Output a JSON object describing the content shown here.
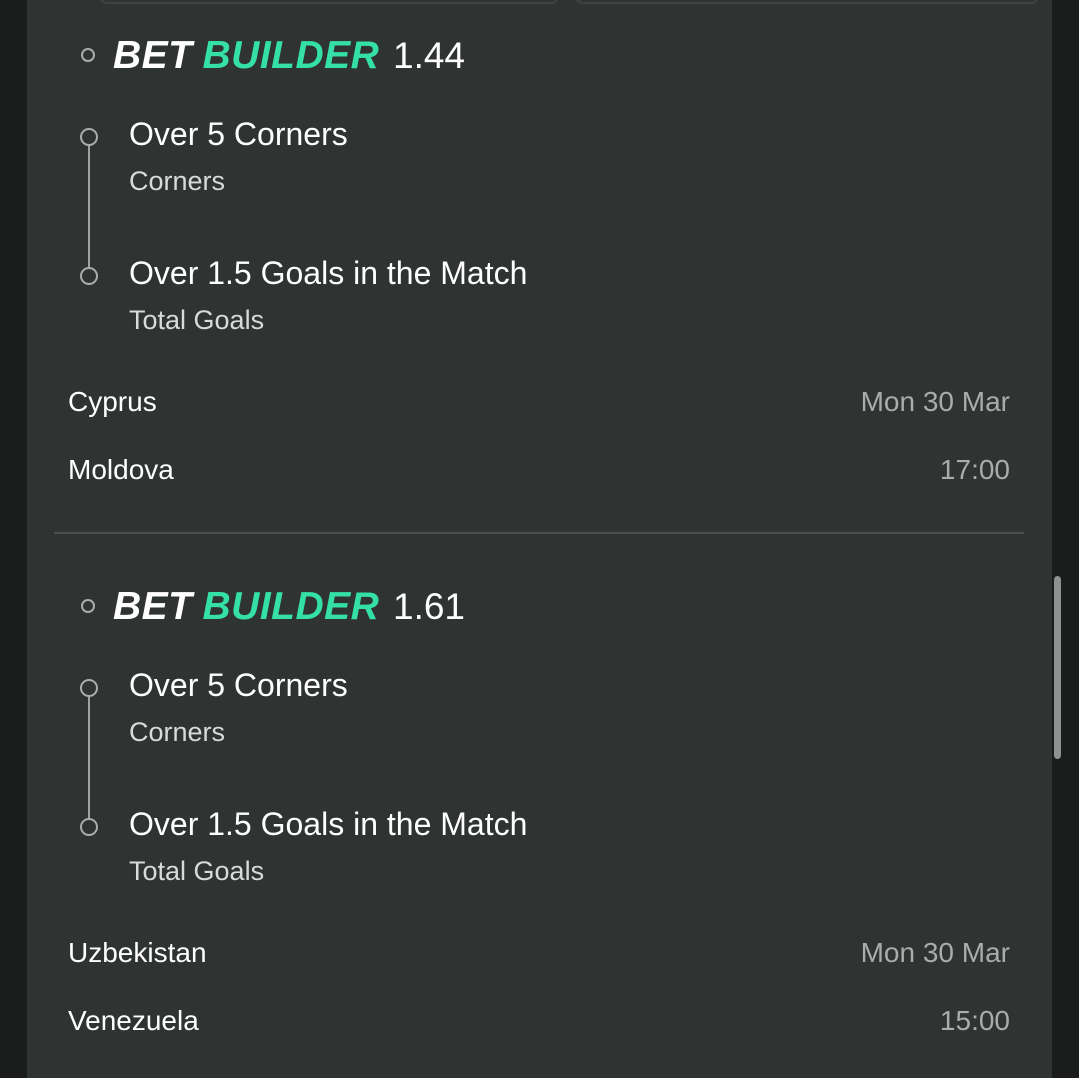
{
  "bets": [
    {
      "logo_bet": "BET",
      "logo_builder": "BUILDER",
      "odds": "1.44",
      "legs": [
        {
          "title": "Over 5 Corners",
          "market": "Corners"
        },
        {
          "title": "Over 1.5 Goals in the Match",
          "market": "Total Goals"
        }
      ],
      "home_team": "Cyprus",
      "away_team": "Moldova",
      "date": "Mon 30 Mar",
      "time": "17:00"
    },
    {
      "logo_bet": "BET",
      "logo_builder": "BUILDER",
      "odds": "1.61",
      "legs": [
        {
          "title": "Over 5 Corners",
          "market": "Corners"
        },
        {
          "title": "Over 1.5 Goals in the Match",
          "market": "Total Goals"
        }
      ],
      "home_team": "Uzbekistan",
      "away_team": "Venezuela",
      "date": "Mon 30 Mar",
      "time": "15:00"
    }
  ],
  "colors": {
    "background": "#1b1d1c",
    "panel": "#2f3331",
    "accent_builder": "#35e0a8",
    "text_primary": "#ffffff",
    "text_muted": "#a8acaa"
  }
}
